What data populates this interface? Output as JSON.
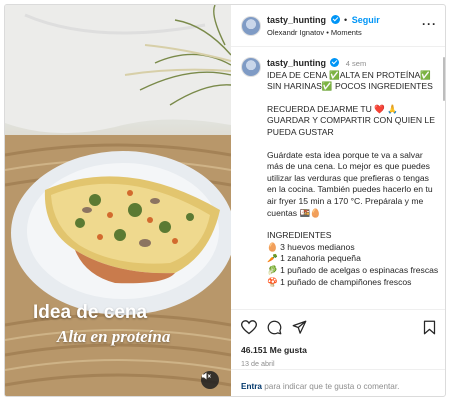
{
  "media": {
    "caption_line1": "Idea de cena",
    "caption_line2": "Alta en proteína",
    "mute_icon": "speaker-muted-icon"
  },
  "header": {
    "username": "tasty_hunting",
    "follow_label": "Seguir",
    "separator": "•",
    "audio": "Olexandr Ignatov • Moments",
    "more_icon": "ellipsis-icon"
  },
  "caption": {
    "username": "tasty_hunting",
    "time_ago": "4 sem",
    "lines": [
      "IDEA DE CENA ✅ALTA EN PROTEÍNA✅ SIN HARINAS✅ POCOS INGREDIENTES",
      "RECUERDA DEJARME TU ❤️ 🙏 GUARDAR Y COMPARTIR CON QUIEN LE PUEDA GUSTAR",
      "Guárdate esta idea porque te va a salvar más de una cena. Lo mejor es que puedes utilizar las verduras que prefieras o tengas en la cocina. También puedes hacerlo en tu air fryer 15 min a 170 °C. Prepárala y me cuentas 🍱🥚",
      "INGREDIENTES"
    ],
    "ingredients": [
      "🥚 3 huevos medianos",
      "🥕 1 zanahoria pequeña",
      "🥬 1 puñado de acelgas o espinacas frescas",
      "🍄 1 puñado de champiñones frescos"
    ]
  },
  "actions": {
    "like_icon": "heart-icon",
    "comment_icon": "comment-icon",
    "share_icon": "send-icon",
    "save_icon": "bookmark-icon",
    "likes": "46.151 Me gusta",
    "date": "13 de abril"
  },
  "footer": {
    "login_link": "Entra",
    "login_text": " para indicar que te gusta o comentar."
  },
  "colors": {
    "accent": "#0095f6",
    "link": "#00376b",
    "muted": "#8e8e8e",
    "border": "#dbdbdb"
  }
}
